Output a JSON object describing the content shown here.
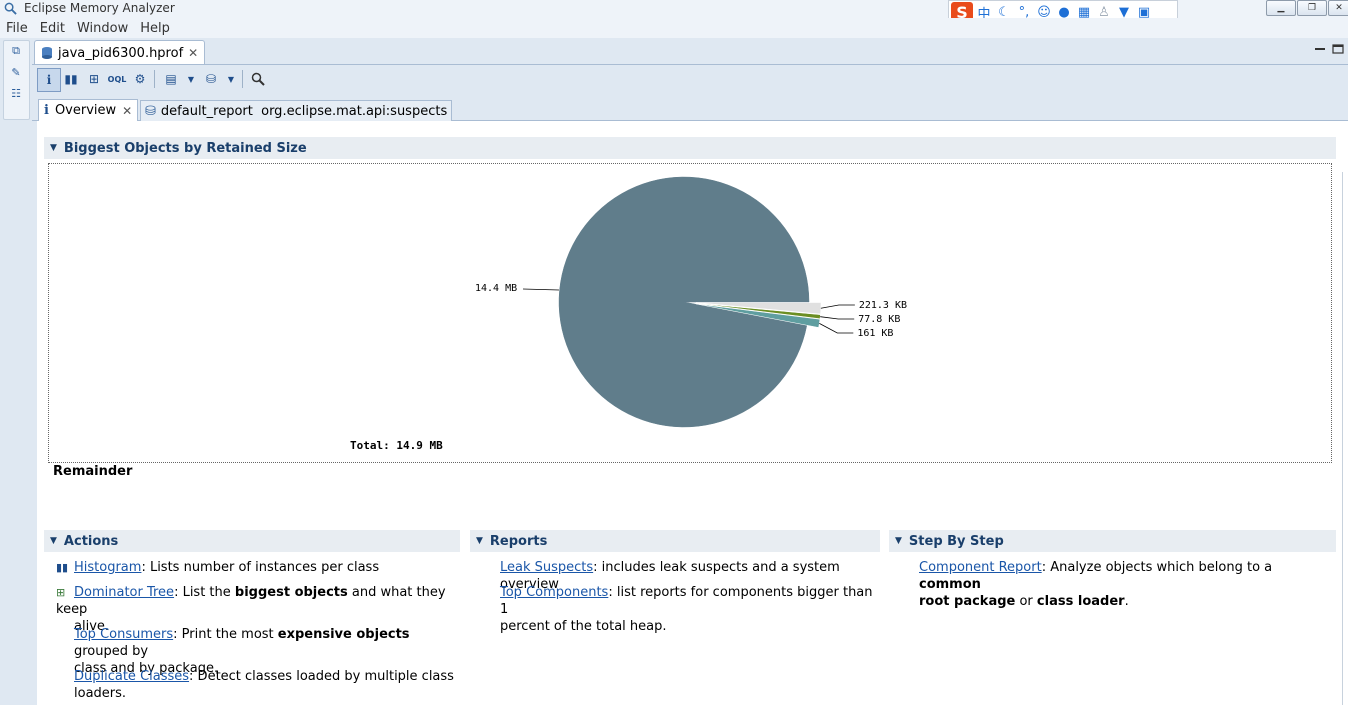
{
  "window": {
    "title": "Eclipse Memory Analyzer"
  },
  "menu": {
    "file": "File",
    "edit": "Edit",
    "window": "Window",
    "help": "Help"
  },
  "ime": {
    "mode_label": "中",
    "brand_label": "S"
  },
  "editor": {
    "file_tab_label": "java_pid6300.hprof"
  },
  "inner_tabs": {
    "overview_label": "Overview",
    "report_label": "default_report  org.eclipse.mat.api:suspects"
  },
  "biggest": {
    "header": "Biggest Objects by Retained Size",
    "remainder_label": "Remainder"
  },
  "chart_data": {
    "type": "pie",
    "title": "",
    "total_label": "Total: 14.9 MB",
    "slices": [
      {
        "label": "14.4 MB",
        "value": 14745.6,
        "color": "#607d8b"
      },
      {
        "label": "221.3 KB",
        "value": 221.3,
        "color": "#e0e0e0"
      },
      {
        "label": "77.8 KB",
        "value": 77.8,
        "color": "#6b8e23"
      },
      {
        "label": "161 KB",
        "value": 161,
        "color": "#5f9ea0"
      }
    ]
  },
  "actions": {
    "header": "Actions",
    "histogram_link": "Histogram",
    "histogram_desc": ": Lists number of instances per class",
    "dominator_link": "Dominator Tree",
    "dominator_desc1": ": List the ",
    "dominator_bold": "biggest objects",
    "dominator_desc2": " and what they keep",
    "dominator_desc3": "alive.",
    "consumers_link": "Top Consumers",
    "consumers_desc1": ": Print the most ",
    "consumers_bold": "expensive objects",
    "consumers_desc2": " grouped by",
    "consumers_desc3": "class and by package.",
    "duplicate_link": "Duplicate Classes",
    "duplicate_desc1": ": Detect classes loaded by multiple class",
    "duplicate_desc2": "loaders."
  },
  "reports": {
    "header": "Reports",
    "leak_link": "Leak Suspects",
    "leak_desc": ": includes leak suspects and a system overview",
    "top_link": "Top Components",
    "top_desc1": ": list reports for components bigger than 1",
    "top_desc2": "percent of the total heap."
  },
  "step": {
    "header": "Step By Step",
    "component_link": "Component Report",
    "component_desc1": ": Analyze objects which belong to a ",
    "component_bold1": "common",
    "component_bold2": "root package",
    "component_desc2": " or ",
    "component_bold3": "class loader",
    "component_desc3": "."
  }
}
